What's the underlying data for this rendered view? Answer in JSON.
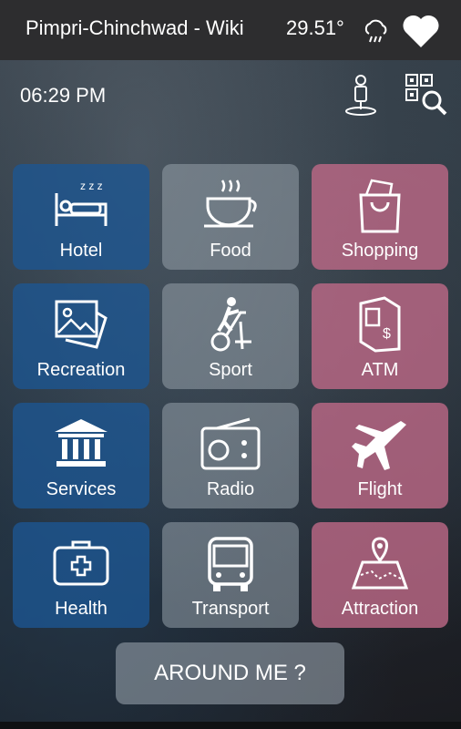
{
  "header": {
    "title": "Pimpri-Chinchwad - Wiki",
    "temperature": "29.51°",
    "weather_icon": "rain-cloud-icon",
    "favorite_icon": "heart-icon"
  },
  "subheader": {
    "time": "06:29 PM",
    "nearby_icon": "person-pin-icon",
    "scan_icon": "qr-search-icon"
  },
  "tiles": [
    {
      "label": "Hotel",
      "icon": "bed-icon",
      "color": "#1c5692"
    },
    {
      "label": "Food",
      "icon": "coffee-cup-icon",
      "color": "#96a0aa"
    },
    {
      "label": "Shopping",
      "icon": "shopping-bag-icon",
      "color": "#be6987"
    },
    {
      "label": "Recreation",
      "icon": "photos-icon",
      "color": "#1c5692"
    },
    {
      "label": "Sport",
      "icon": "exercise-bike-icon",
      "color": "#96a0aa"
    },
    {
      "label": "ATM",
      "icon": "atm-icon",
      "color": "#be6987"
    },
    {
      "label": "Services",
      "icon": "bank-icon",
      "color": "#1c5692"
    },
    {
      "label": "Radio",
      "icon": "radio-icon",
      "color": "#96a0aa"
    },
    {
      "label": "Flight",
      "icon": "airplane-icon",
      "color": "#be6987"
    },
    {
      "label": "Health",
      "icon": "first-aid-icon",
      "color": "#1c5692"
    },
    {
      "label": "Transport",
      "icon": "bus-icon",
      "color": "#96a0aa"
    },
    {
      "label": "Attraction",
      "icon": "map-pin-icon",
      "color": "#be6987"
    }
  ],
  "around_me": {
    "label": "AROUND ME ?"
  }
}
